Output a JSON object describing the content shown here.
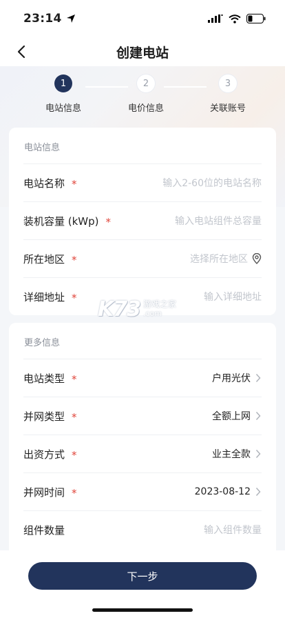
{
  "status_bar": {
    "time": "23:14"
  },
  "nav": {
    "title": "创建电站"
  },
  "stepper": {
    "steps": [
      {
        "number": "1",
        "label": "电站信息"
      },
      {
        "number": "2",
        "label": "电价信息"
      },
      {
        "number": "3",
        "label": "关联账号"
      }
    ]
  },
  "station_info": {
    "section_title": "电站信息",
    "name": {
      "label": "电站名称",
      "required": "*",
      "placeholder": "输入2-60位的电站名称"
    },
    "capacity": {
      "label": "装机容量 (kWp)",
      "required": "*",
      "placeholder": "输入电站组件总容量"
    },
    "region": {
      "label": "所在地区",
      "required": "*",
      "placeholder": "选择所在地区"
    },
    "address": {
      "label": "详细地址",
      "required": "*",
      "placeholder": "输入详细地址"
    }
  },
  "more_info": {
    "section_title": "更多信息",
    "station_type": {
      "label": "电站类型",
      "required": "*",
      "value": "户用光伏"
    },
    "grid_type": {
      "label": "并网类型",
      "required": "*",
      "value": "全额上网"
    },
    "funding": {
      "label": "出资方式",
      "required": "*",
      "value": "业主全款"
    },
    "grid_time": {
      "label": "并网时间",
      "required": "*",
      "value": "2023-08-12"
    },
    "module_count": {
      "label": "组件数量",
      "placeholder": "输入组件数量"
    }
  },
  "footer": {
    "next_label": "下一步"
  },
  "watermark": {
    "brand": "K73",
    "site_cn": "游戏之家",
    "site_com": ".com"
  },
  "colors": {
    "primary": "#22345c",
    "required": "#e0453a",
    "placeholder": "#c2c6cd"
  }
}
